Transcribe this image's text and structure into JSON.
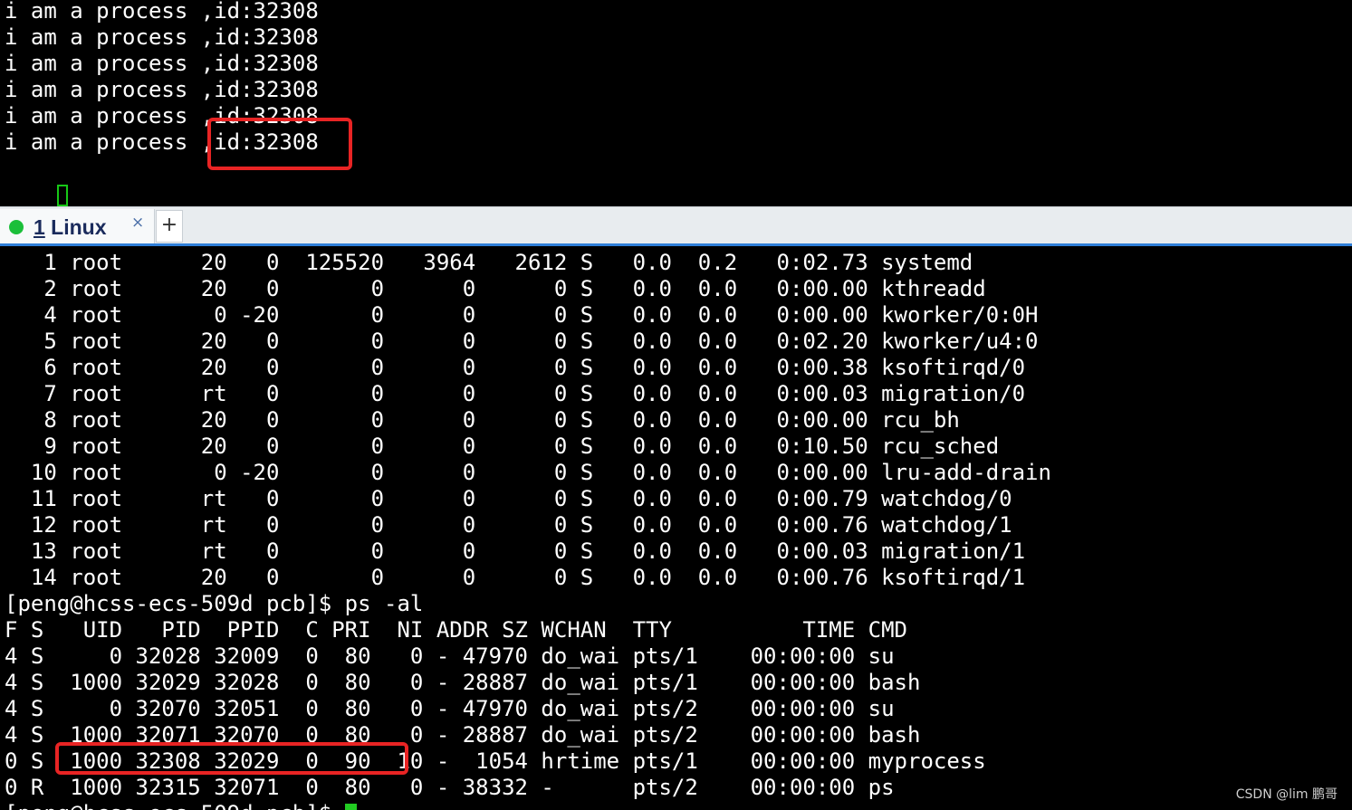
{
  "top_terminal": {
    "output_lines": [
      "i am a process ,id:32308",
      "i am a process ,id:32308",
      "i am a process ,id:32308",
      "i am a process ,id:32308",
      "i am a process ,id:32308",
      "i am a process ,id:32308"
    ]
  },
  "tabbar": {
    "tab_number": "1",
    "tab_name": " Linux",
    "close_glyph": "×",
    "add_glyph": "+"
  },
  "bottom_terminal": {
    "top_rows": [
      "   1 root      20   0  125520   3964   2612 S   0.0  0.2   0:02.73 systemd",
      "   2 root      20   0       0      0      0 S   0.0  0.0   0:00.00 kthreadd",
      "   4 root       0 -20       0      0      0 S   0.0  0.0   0:00.00 kworker/0:0H",
      "   5 root      20   0       0      0      0 S   0.0  0.0   0:02.20 kworker/u4:0",
      "   6 root      20   0       0      0      0 S   0.0  0.0   0:00.38 ksoftirqd/0",
      "   7 root      rt   0       0      0      0 S   0.0  0.0   0:00.03 migration/0",
      "   8 root      20   0       0      0      0 S   0.0  0.0   0:00.00 rcu_bh",
      "   9 root      20   0       0      0      0 S   0.0  0.0   0:10.50 rcu_sched",
      "  10 root       0 -20       0      0      0 S   0.0  0.0   0:00.00 lru-add-drain",
      "  11 root      rt   0       0      0      0 S   0.0  0.0   0:00.79 watchdog/0",
      "  12 root      rt   0       0      0      0 S   0.0  0.0   0:00.76 watchdog/1",
      "  13 root      rt   0       0      0      0 S   0.0  0.0   0:00.03 migration/1",
      "  14 root      20   0       0      0      0 S   0.0  0.0   0:00.76 ksoftirqd/1"
    ],
    "prompt_command": "[peng@hcss-ecs-509d pcb]$ ps -al",
    "ps_header": "F S   UID   PID  PPID  C PRI  NI ADDR SZ WCHAN  TTY          TIME CMD",
    "ps_rows": [
      "4 S     0 32028 32009  0  80   0 - 47970 do_wai pts/1    00:00:00 su",
      "4 S  1000 32029 32028  0  80   0 - 28887 do_wai pts/1    00:00:00 bash",
      "4 S     0 32070 32051  0  80   0 - 47970 do_wai pts/2    00:00:00 su",
      "4 S  1000 32071 32070  0  80   0 - 28887 do_wai pts/2    00:00:00 bash",
      "0 S  1000 32308 32029  0  90  10 -  1054 hrtime pts/1    00:00:00 myprocess",
      "0 R  1000 32315 32071  0  80   0 - 38332 -      pts/2    00:00:00 ps"
    ],
    "last_prompt_partial": "[peng@hcss-ecs-509d pcb]$ "
  },
  "watermark": "CSDN @lim 鹏哥",
  "colors": {
    "terminal_bg": "#000000",
    "terminal_fg": "#ffffff",
    "cursor": "#22cc22",
    "highlight_box": "#e82424",
    "tab_active_dot": "#1bbf3a",
    "tab_underline": "#2f7fd8"
  }
}
